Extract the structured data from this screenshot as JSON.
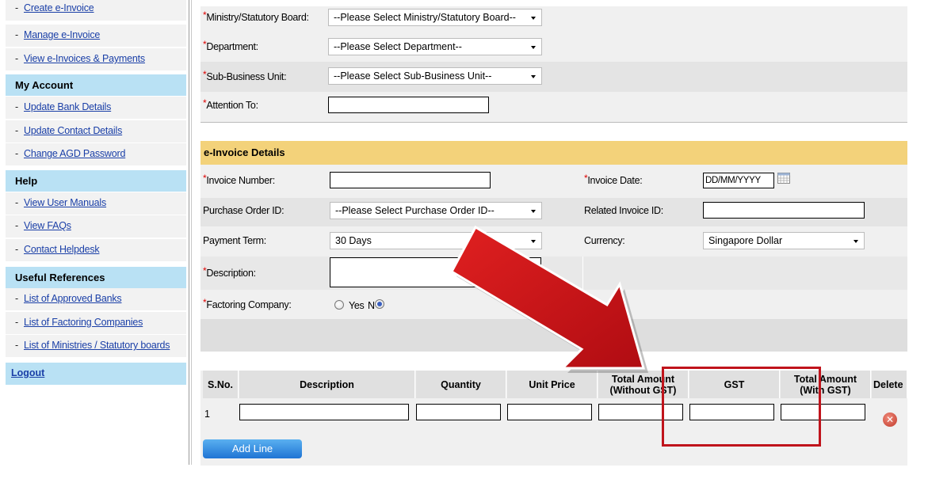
{
  "sidebar": {
    "top_links": [
      "Create e-Invoice",
      "Manage e-Invoice",
      "View e-Invoices & Payments"
    ],
    "my_account": {
      "title": "My Account",
      "links": [
        "Update Bank Details",
        "Update Contact Details",
        "Change AGD Password"
      ]
    },
    "help": {
      "title": "Help",
      "links": [
        "View User Manuals",
        "View FAQs",
        "Contact Helpdesk"
      ]
    },
    "useful_references": {
      "title": "Useful References",
      "links": [
        "List of Approved Banks",
        "List of Factoring Companies",
        "List of Ministries / Statutory boards"
      ]
    },
    "logout": "Logout"
  },
  "org": {
    "ministry_label": "Ministry/Statutory Board:",
    "ministry_value": "--Please Select Ministry/Statutory Board--",
    "department_label": "Department:",
    "department_value": "--Please Select Department--",
    "sbu_label": "Sub-Business Unit:",
    "sbu_value": "--Please Select Sub-Business Unit--",
    "attention_label": "Attention To:",
    "attention_value": ""
  },
  "invoice": {
    "section_title": "e-Invoice Details",
    "invoice_number_label": "Invoice Number:",
    "invoice_date_label": "Invoice Date:",
    "invoice_date_placeholder": "DD/MM/YYYY",
    "po_label": "Purchase Order ID:",
    "po_value": "--Please Select Purchase Order ID--",
    "related_invoice_label": "Related Invoice ID:",
    "payment_term_label": "Payment Term:",
    "payment_term_value": "30 Days",
    "currency_label": "Currency:",
    "currency_value": "Singapore Dollar",
    "description_label": "Description:",
    "factoring_label": "Factoring Company:",
    "factoring_yes": "Yes",
    "factoring_no": "N",
    "factoring_selected": "No"
  },
  "line_items": {
    "headers": {
      "sno": "S.No.",
      "description": "Description",
      "quantity": "Quantity",
      "unit_price": "Unit Price",
      "total_without_gst_1": "Total Amount",
      "total_without_gst_2": "(Without GST)",
      "gst": "GST",
      "total_with_gst_1": "Total Amount",
      "total_with_gst_2": "(With GST)",
      "delete": "Delete"
    },
    "rows": [
      {
        "sno": "1"
      }
    ],
    "add_line_label": "Add Line"
  },
  "annotation": {
    "color": "#c0141c"
  },
  "icons": {
    "calendar": "calendar-icon",
    "delete": "delete-icon",
    "caret": "chevron-down-icon"
  }
}
